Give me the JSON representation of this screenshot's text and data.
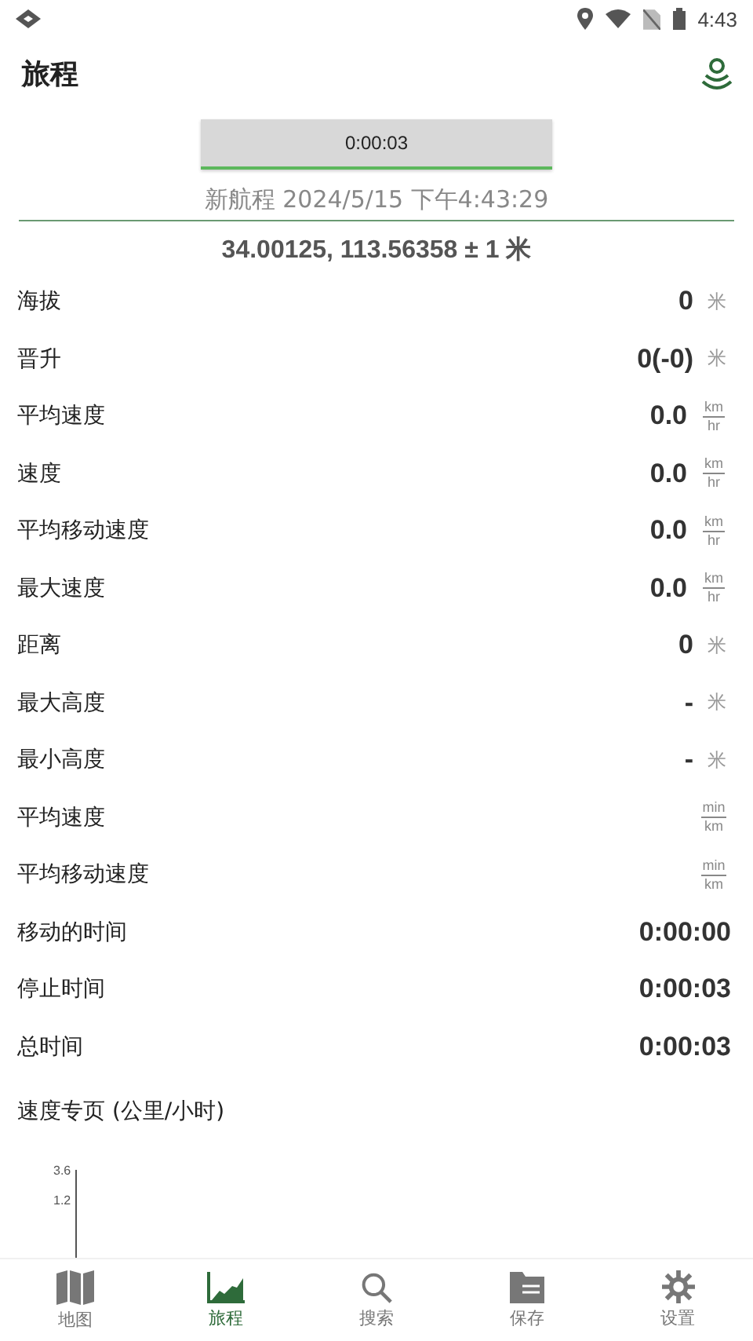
{
  "status_bar": {
    "time": "4:43"
  },
  "app_bar": {
    "title": "旅程"
  },
  "timer_button": {
    "label": "0:00:03"
  },
  "trip_name": "新航程 2024/5/15 下午4:43:29",
  "coordinates": "34.00125, 113.56358 ± 1 米",
  "stats": [
    {
      "label": "海拔",
      "value": "0",
      "kind": "unit",
      "unit": "米"
    },
    {
      "label": "晋升",
      "value": "0(-0)",
      "kind": "unit",
      "unit": "米"
    },
    {
      "label": "平均速度",
      "value": "0.0",
      "kind": "fraction",
      "numerator": "km",
      "denominator": "hr"
    },
    {
      "label": "速度",
      "value": "0.0",
      "kind": "fraction",
      "numerator": "km",
      "denominator": "hr"
    },
    {
      "label": "平均移动速度",
      "value": "0.0",
      "kind": "fraction",
      "numerator": "km",
      "denominator": "hr"
    },
    {
      "label": "最大速度",
      "value": "0.0",
      "kind": "fraction",
      "numerator": "km",
      "denominator": "hr"
    },
    {
      "label": "距离",
      "value": "0",
      "kind": "unit",
      "unit": "米"
    },
    {
      "label": "最大高度",
      "value": "-",
      "kind": "unit",
      "unit": "米"
    },
    {
      "label": "最小高度",
      "value": "-",
      "kind": "unit",
      "unit": "米"
    },
    {
      "label": "平均速度",
      "kind": "fraction",
      "numerator": "min",
      "denominator": "km"
    },
    {
      "label": "平均移动速度",
      "kind": "fraction",
      "numerator": "min",
      "denominator": "km"
    },
    {
      "label": "移动的时间",
      "value": "0:00:00",
      "kind": "time"
    },
    {
      "label": "停止时间",
      "value": "0:00:03",
      "kind": "time"
    },
    {
      "label": "总时间",
      "value": "0:00:03",
      "kind": "time"
    }
  ],
  "speed_profile": {
    "title": "速度专页 (公里/小时)",
    "y_labels": [
      "3.6",
      "1.2"
    ]
  },
  "bottom_nav": [
    {
      "label": "地图",
      "kind": "map",
      "selected": false
    },
    {
      "label": "旅程",
      "kind": "chart",
      "selected": true
    },
    {
      "label": "搜索",
      "kind": "search",
      "selected": false
    },
    {
      "label": "保存",
      "kind": "folder",
      "selected": false
    },
    {
      "label": "设置",
      "kind": "gear",
      "selected": false
    }
  ]
}
